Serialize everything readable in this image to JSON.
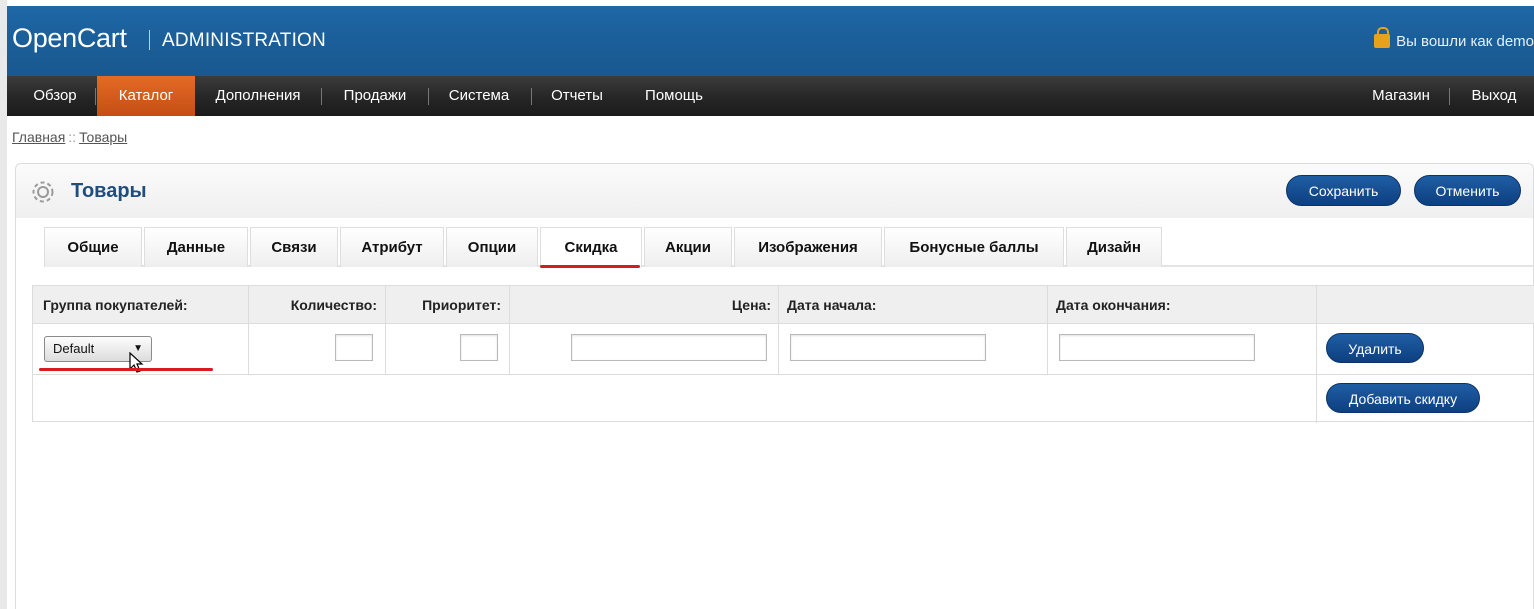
{
  "header": {
    "logo": "OpenCart",
    "subtitle": "ADMINISTRATION",
    "login_text": "Вы вошли как demo"
  },
  "menu": {
    "items": [
      "Обзор",
      "Каталог",
      "Дополнения",
      "Продажи",
      "Система",
      "Отчеты",
      "Помощь"
    ],
    "active": "Каталог",
    "right_items": [
      "Магазин",
      "Выход"
    ]
  },
  "breadcrumb": {
    "items": [
      "Главная",
      "Товары"
    ],
    "separator": "::"
  },
  "page": {
    "title": "Товары",
    "save_label": "Сохранить",
    "cancel_label": "Отменить"
  },
  "tabs": {
    "items": [
      "Общие",
      "Данные",
      "Связи",
      "Атрибут",
      "Опции",
      "Скидка",
      "Акции",
      "Изображения",
      "Бонусные баллы",
      "Дизайн"
    ],
    "selected": "Скидка"
  },
  "discount_table": {
    "headers": {
      "customer_group": "Группа покупателей:",
      "quantity": "Количество:",
      "priority": "Приоритет:",
      "price": "Цена:",
      "date_start": "Дата начала:",
      "date_end": "Дата окончания:"
    },
    "row": {
      "customer_group_value": "Default",
      "quantity": "",
      "priority": "",
      "price": "",
      "date_start": "",
      "date_end": "",
      "delete_label": "Удалить"
    },
    "add_label": "Добавить скидку"
  },
  "colors": {
    "header_blue": "#1b5f9a",
    "menu_active": "#d65c1c",
    "button_blue": "#164f93",
    "highlight_red": "#d81b22",
    "title_blue": "#1f4d7d"
  }
}
